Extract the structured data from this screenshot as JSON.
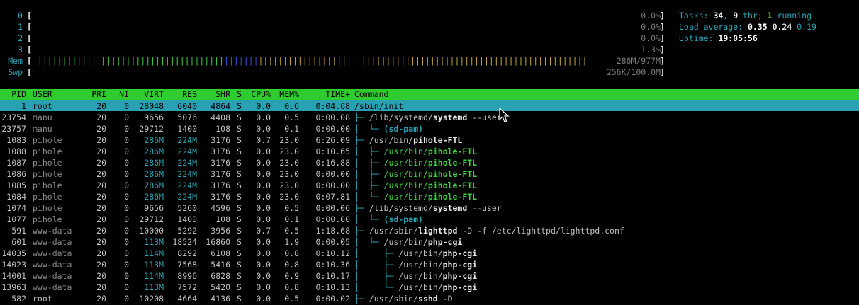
{
  "meters": {
    "cpus": [
      {
        "label": "0",
        "bar_green": "",
        "bar_red": "",
        "value": "0.0%"
      },
      {
        "label": "1",
        "bar_green": "",
        "bar_red": "",
        "value": "0.0%"
      },
      {
        "label": "2",
        "bar_green": "",
        "bar_red": "",
        "value": "0.0%"
      },
      {
        "label": "3",
        "bar_green": "|",
        "bar_red": "|",
        "value": "1.3%"
      }
    ],
    "mem": {
      "label": "Mem",
      "value": "286M/977M",
      "fill_used": 0.29
    },
    "swp": {
      "label": "Swp",
      "value": "256K/100.0M",
      "fill_used": 0.003
    }
  },
  "summary": {
    "tasks_label": "Tasks: ",
    "tasks": "34",
    "sep1": ", ",
    "thr": "9",
    "thr_label": " thr; ",
    "running": "1",
    "running_label": " running",
    "load_label": "Load average: ",
    "load1": "0.35",
    "load5": "0.24",
    "load15": "0.19",
    "uptime_label": "Uptime: ",
    "uptime": "19:05:56"
  },
  "header": {
    "pid": "PID",
    "user": "USER",
    "pri": "PRI",
    "ni": "NI",
    "virt": "VIRT",
    "res": "RES",
    "shr": "SHR",
    "s": "S",
    "cpu": "CPU%",
    "mem": "MEM%",
    "time": "TIME+",
    "command": "Command"
  },
  "processes": [
    {
      "pid": "1",
      "user": "root",
      "pri": "20",
      "ni": "0",
      "virt": "28048",
      "res": "6040",
      "shr": "4864",
      "s": "S",
      "cpu": "0.0",
      "mem": "0.6",
      "time": "0:04.68",
      "tree": "",
      "path": "/sbin/init",
      "bin": "",
      "args": "",
      "selected": true,
      "green": false
    },
    {
      "pid": "23754",
      "user": "manu",
      "pri": "20",
      "ni": "0",
      "virt": "9656",
      "res": "5076",
      "shr": "4408",
      "s": "S",
      "cpu": "0.0",
      "mem": "0.5",
      "time": "0:00.08",
      "tree": "├─ ",
      "path": "/lib/systemd/",
      "bin": "systemd",
      "args": " --user",
      "selected": false,
      "green": false
    },
    {
      "pid": "23757",
      "user": "manu",
      "pri": "20",
      "ni": "0",
      "virt": "29712",
      "res": "1400",
      "shr": "108",
      "s": "S",
      "cpu": "0.0",
      "mem": "0.1",
      "time": "0:00.00",
      "tree": "│  └─ ",
      "path": "",
      "bin": "(sd-pam)",
      "args": "",
      "selected": false,
      "green": false
    },
    {
      "pid": "1083",
      "user": "pihole",
      "pri": "20",
      "ni": "0",
      "virt": "286M",
      "res": "224M",
      "shr": "3176",
      "s": "S",
      "cpu": "0.7",
      "mem": "23.0",
      "time": "6:26.09",
      "tree": "├─ ",
      "path": "/usr/bin/",
      "bin": "pihole-FTL",
      "args": "",
      "selected": false,
      "green": false
    },
    {
      "pid": "1088",
      "user": "pihole",
      "pri": "20",
      "ni": "0",
      "virt": "286M",
      "res": "224M",
      "shr": "3176",
      "s": "S",
      "cpu": "0.0",
      "mem": "23.0",
      "time": "0:10.65",
      "tree": "│  ├─ ",
      "path": "/usr/bin/",
      "bin": "pihole-FTL",
      "args": "",
      "selected": false,
      "green": true
    },
    {
      "pid": "1087",
      "user": "pihole",
      "pri": "20",
      "ni": "0",
      "virt": "286M",
      "res": "224M",
      "shr": "3176",
      "s": "S",
      "cpu": "0.0",
      "mem": "23.0",
      "time": "0:16.88",
      "tree": "│  ├─ ",
      "path": "/usr/bin/",
      "bin": "pihole-FTL",
      "args": "",
      "selected": false,
      "green": true
    },
    {
      "pid": "1086",
      "user": "pihole",
      "pri": "20",
      "ni": "0",
      "virt": "286M",
      "res": "224M",
      "shr": "3176",
      "s": "S",
      "cpu": "0.0",
      "mem": "23.0",
      "time": "0:00.00",
      "tree": "│  ├─ ",
      "path": "/usr/bin/",
      "bin": "pihole-FTL",
      "args": "",
      "selected": false,
      "green": true
    },
    {
      "pid": "1085",
      "user": "pihole",
      "pri": "20",
      "ni": "0",
      "virt": "286M",
      "res": "224M",
      "shr": "3176",
      "s": "S",
      "cpu": "0.0",
      "mem": "23.0",
      "time": "0:00.00",
      "tree": "│  ├─ ",
      "path": "/usr/bin/",
      "bin": "pihole-FTL",
      "args": "",
      "selected": false,
      "green": true
    },
    {
      "pid": "1084",
      "user": "pihole",
      "pri": "20",
      "ni": "0",
      "virt": "286M",
      "res": "224M",
      "shr": "3176",
      "s": "S",
      "cpu": "0.0",
      "mem": "23.0",
      "time": "0:07.81",
      "tree": "│  └─ ",
      "path": "/usr/bin/",
      "bin": "pihole-FTL",
      "args": "",
      "selected": false,
      "green": true
    },
    {
      "pid": "1074",
      "user": "pihole",
      "pri": "20",
      "ni": "0",
      "virt": "9656",
      "res": "5260",
      "shr": "4596",
      "s": "S",
      "cpu": "0.0",
      "mem": "0.5",
      "time": "0:00.06",
      "tree": "├─ ",
      "path": "/lib/systemd/",
      "bin": "systemd",
      "args": " --user",
      "selected": false,
      "green": false
    },
    {
      "pid": "1077",
      "user": "pihole",
      "pri": "20",
      "ni": "0",
      "virt": "29712",
      "res": "1400",
      "shr": "108",
      "s": "S",
      "cpu": "0.0",
      "mem": "0.1",
      "time": "0:00.00",
      "tree": "│  └─ ",
      "path": "",
      "bin": "(sd-pam)",
      "args": "",
      "selected": false,
      "green": false
    },
    {
      "pid": "591",
      "user": "www-data",
      "pri": "20",
      "ni": "0",
      "virt": "10000",
      "res": "5292",
      "shr": "3956",
      "s": "S",
      "cpu": "0.7",
      "mem": "0.5",
      "time": "1:18.68",
      "tree": "├─ ",
      "path": "/usr/sbin/",
      "bin": "lighttpd",
      "args": " -D -f /etc/lighttpd/lighttpd.conf",
      "selected": false,
      "green": false
    },
    {
      "pid": "601",
      "user": "www-data",
      "pri": "20",
      "ni": "0",
      "virt": "113M",
      "res": "18524",
      "shr": "16860",
      "s": "S",
      "cpu": "0.0",
      "mem": "1.9",
      "time": "0:00.05",
      "tree": "│  └─ ",
      "path": "/usr/bin/",
      "bin": "php-cgi",
      "args": "",
      "selected": false,
      "green": false
    },
    {
      "pid": "14035",
      "user": "www-data",
      "pri": "20",
      "ni": "0",
      "virt": "114M",
      "res": "8292",
      "shr": "6108",
      "s": "S",
      "cpu": "0.0",
      "mem": "0.8",
      "time": "0:10.12",
      "tree": "│     ├─ ",
      "path": "/usr/bin/",
      "bin": "php-cgi",
      "args": "",
      "selected": false,
      "green": false
    },
    {
      "pid": "14023",
      "user": "www-data",
      "pri": "20",
      "ni": "0",
      "virt": "113M",
      "res": "7568",
      "shr": "5416",
      "s": "S",
      "cpu": "0.0",
      "mem": "0.8",
      "time": "0:10.36",
      "tree": "│     ├─ ",
      "path": "/usr/bin/",
      "bin": "php-cgi",
      "args": "",
      "selected": false,
      "green": false
    },
    {
      "pid": "14001",
      "user": "www-data",
      "pri": "20",
      "ni": "0",
      "virt": "114M",
      "res": "8996",
      "shr": "6828",
      "s": "S",
      "cpu": "0.0",
      "mem": "0.9",
      "time": "0:10.17",
      "tree": "│     ├─ ",
      "path": "/usr/bin/",
      "bin": "php-cgi",
      "args": "",
      "selected": false,
      "green": false
    },
    {
      "pid": "13963",
      "user": "www-data",
      "pri": "20",
      "ni": "0",
      "virt": "113M",
      "res": "7572",
      "shr": "5420",
      "s": "S",
      "cpu": "0.0",
      "mem": "0.8",
      "time": "0:10.13",
      "tree": "│     └─ ",
      "path": "/usr/bin/",
      "bin": "php-cgi",
      "args": "",
      "selected": false,
      "green": false
    },
    {
      "pid": "582",
      "user": "root",
      "pri": "20",
      "ni": "0",
      "virt": "10208",
      "res": "4664",
      "shr": "4136",
      "s": "S",
      "cpu": "0.0",
      "mem": "0.5",
      "time": "0:00.02",
      "tree": "├─ ",
      "path": "/usr/sbin/",
      "bin": "sshd",
      "args": " -D",
      "selected": false,
      "green": false
    }
  ],
  "colors": {
    "header_bg": "#2ecc2e",
    "selected_bg": "#2aa1b3",
    "accent": "#2aa1b3"
  }
}
